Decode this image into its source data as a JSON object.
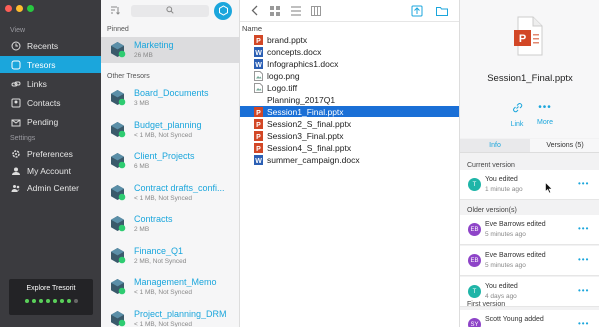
{
  "sidebar": {
    "section_view": "View",
    "section_settings": "Settings",
    "items": [
      {
        "label": "Recents",
        "icon": "clock-icon"
      },
      {
        "label": "Tresors",
        "icon": "tresor-icon"
      },
      {
        "label": "Links",
        "icon": "link-icon"
      },
      {
        "label": "Contacts",
        "icon": "contacts-icon"
      },
      {
        "label": "Pending",
        "icon": "pending-icon"
      }
    ],
    "settings_items": [
      {
        "label": "Preferences",
        "icon": "gear-icon"
      },
      {
        "label": "My Account",
        "icon": "user-icon"
      },
      {
        "label": "Admin Center",
        "icon": "admin-icon"
      }
    ],
    "explore": "Explore Tresorit"
  },
  "tresors": {
    "pinned_label": "Pinned",
    "other_label": "Other Tresors",
    "pinned": [
      {
        "name": "Marketing",
        "meta": "26 MB"
      }
    ],
    "others": [
      {
        "name": "Board_Documents",
        "meta": "3 MB"
      },
      {
        "name": "Budget_planning",
        "meta": "< 1 MB, Not Synced"
      },
      {
        "name": "Client_Projects",
        "meta": "6 MB"
      },
      {
        "name": "Contract drafts_confi...",
        "meta": "< 1 MB, Not Synced"
      },
      {
        "name": "Contracts",
        "meta": "2 MB"
      },
      {
        "name": "Finance_Q1",
        "meta": "2 MB, Not Synced"
      },
      {
        "name": "Management_Memo",
        "meta": "< 1 MB, Not Synced"
      },
      {
        "name": "Project_planning_DRM",
        "meta": "< 1 MB, Not Synced"
      }
    ]
  },
  "files": {
    "column_header": "Name",
    "rows": [
      {
        "name": "brand.pptx",
        "type": "pptx"
      },
      {
        "name": "concepts.docx",
        "type": "docx"
      },
      {
        "name": "Infographics1.docx",
        "type": "docx"
      },
      {
        "name": "logo.png",
        "type": "image"
      },
      {
        "name": "Logo.tiff",
        "type": "image"
      },
      {
        "name": "Planning_2017Q1",
        "type": "folder"
      },
      {
        "name": "Session1_Final.pptx",
        "type": "pptx",
        "selected": true
      },
      {
        "name": "Session2_S_final.pptx",
        "type": "pptx"
      },
      {
        "name": "Session3_Final.pptx",
        "type": "pptx"
      },
      {
        "name": "Session4_S_final.pptx",
        "type": "pptx"
      },
      {
        "name": "summer_campaign.docx",
        "type": "docx"
      }
    ]
  },
  "details": {
    "file_name": "Session1_Final.pptx",
    "link_label": "Link",
    "more_label": "More",
    "tabs": [
      "Info",
      "Versions (5)"
    ],
    "current_label": "Current version",
    "older_label": "Older version(s)",
    "first_label": "First version",
    "current": [
      {
        "initials": "T",
        "name": "You edited",
        "time": "1 minute ago",
        "color": "#1fb5a8"
      }
    ],
    "older": [
      {
        "initials": "EB",
        "name": "Eve Barrows edited",
        "time": "5 minutes ago",
        "color": "#8e44c8"
      },
      {
        "initials": "EB",
        "name": "Eve Barrows edited",
        "time": "5 minutes ago",
        "color": "#8e44c8"
      },
      {
        "initials": "T",
        "name": "You edited",
        "time": "4 days ago",
        "color": "#1fb5a8"
      }
    ],
    "first": [
      {
        "initials": "SY",
        "name": "Scott Young added",
        "time": "",
        "color": "#8e44c8"
      }
    ]
  },
  "colors": {
    "accent": "#1ba6dc",
    "selection": "#1a6fd6",
    "sidebar": "#3b3b3f"
  }
}
